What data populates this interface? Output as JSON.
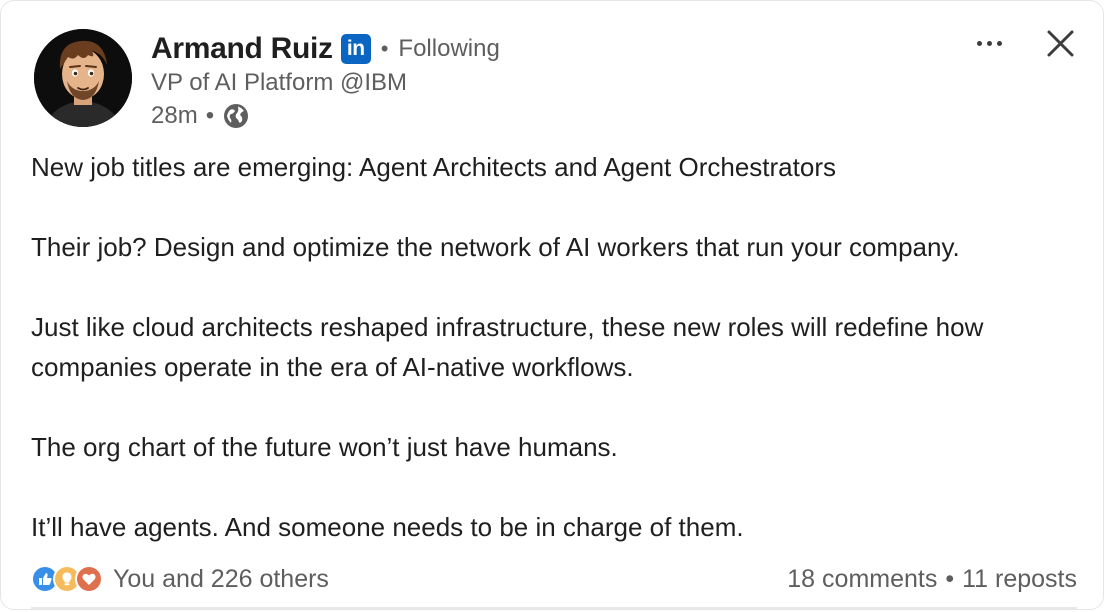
{
  "author": {
    "name": "Armand Ruiz",
    "linkedin_badge": "in",
    "follow_status": "Following",
    "headline": "VP of AI Platform @IBM",
    "time": "28m",
    "visibility_icon": "globe-icon"
  },
  "header_actions": {
    "more_icon": "more-horizontal-icon",
    "close_icon": "close-icon"
  },
  "post": {
    "paragraphs": [
      "New job titles are emerging: Agent Architects and Agent Orchestrators",
      "Their job? Design and optimize the network of AI workers that run your company.",
      "Just like cloud architects reshaped infrastructure, these new roles will redefine how companies operate in the era of AI-native workflows.",
      "The org chart of the future won’t just have humans.",
      "It’ll have agents. And someone needs to be in charge of them."
    ]
  },
  "social": {
    "reaction_icons": [
      "like-icon",
      "insightful-icon",
      "love-icon"
    ],
    "reactions_text": "You and 226 others",
    "comments": "18 comments",
    "separator": "•",
    "reposts": "11 reposts"
  },
  "colors": {
    "linkedin_blue": "#0a66c2",
    "like": "#378fe9",
    "insightful": "#f5bb5c",
    "love": "#df704d",
    "secondary_text": "#5e5e5e"
  }
}
